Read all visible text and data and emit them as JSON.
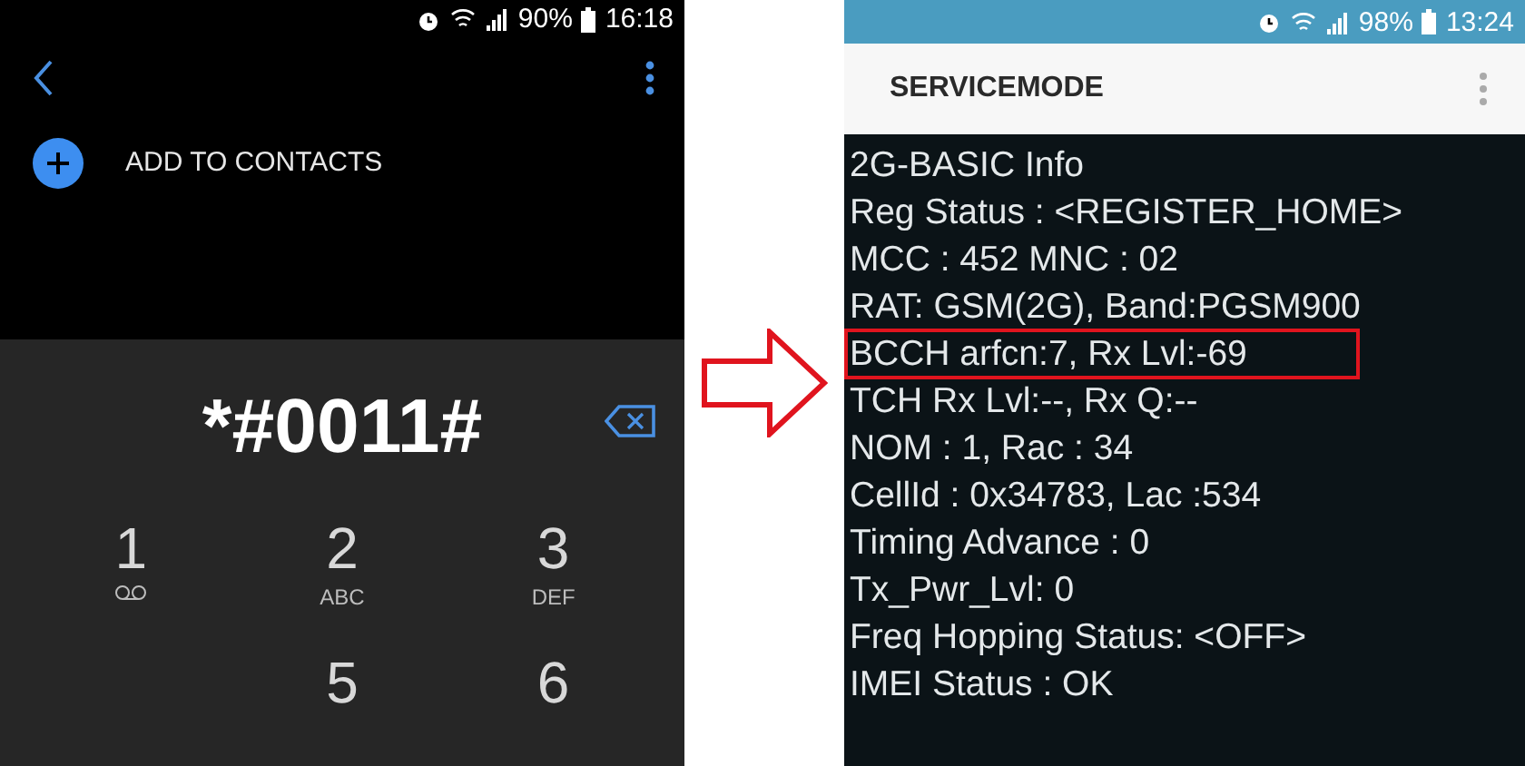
{
  "dialer": {
    "status_bar": {
      "battery": "90%",
      "time": "16:18"
    },
    "add_to_contacts": "ADD TO CONTACTS",
    "number": "*#0011#",
    "keys": [
      {
        "kind": "voicemail",
        "digit": "1"
      },
      {
        "kind": "letters",
        "digit": "2",
        "letters": "ABC"
      },
      {
        "kind": "letters",
        "digit": "3",
        "letters": "DEF"
      },
      {
        "kind": "hidden"
      },
      {
        "kind": "plain",
        "digit": "5"
      },
      {
        "kind": "plain",
        "digit": "6"
      }
    ]
  },
  "service_mode": {
    "status_bar": {
      "battery": "98%",
      "time": "13:24"
    },
    "title": "SERVICEMODE",
    "lines": [
      {
        "text": "2G-BASIC Info",
        "highlighted": false
      },
      {
        "text": "Reg Status : <REGISTER_HOME>",
        "highlighted": false
      },
      {
        "text": "MCC : 452 MNC : 02",
        "highlighted": false
      },
      {
        "text": "RAT: GSM(2G), Band:PGSM900",
        "highlighted": false
      },
      {
        "text": "BCCH arfcn:7, Rx Lvl:-69",
        "highlighted": true
      },
      {
        "text": "TCH Rx Lvl:--, Rx Q:--",
        "highlighted": false
      },
      {
        "text": "NOM : 1, Rac : 34",
        "highlighted": false
      },
      {
        "text": "CellId : 0x34783, Lac :534",
        "highlighted": false
      },
      {
        "text": "Timing Advance : 0",
        "highlighted": false
      },
      {
        "text": "Tx_Pwr_Lvl: 0",
        "highlighted": false
      },
      {
        "text": "Freq Hopping Status: <OFF>",
        "highlighted": false
      },
      {
        "text": "IMEI Status : OK",
        "highlighted": false
      }
    ]
  }
}
